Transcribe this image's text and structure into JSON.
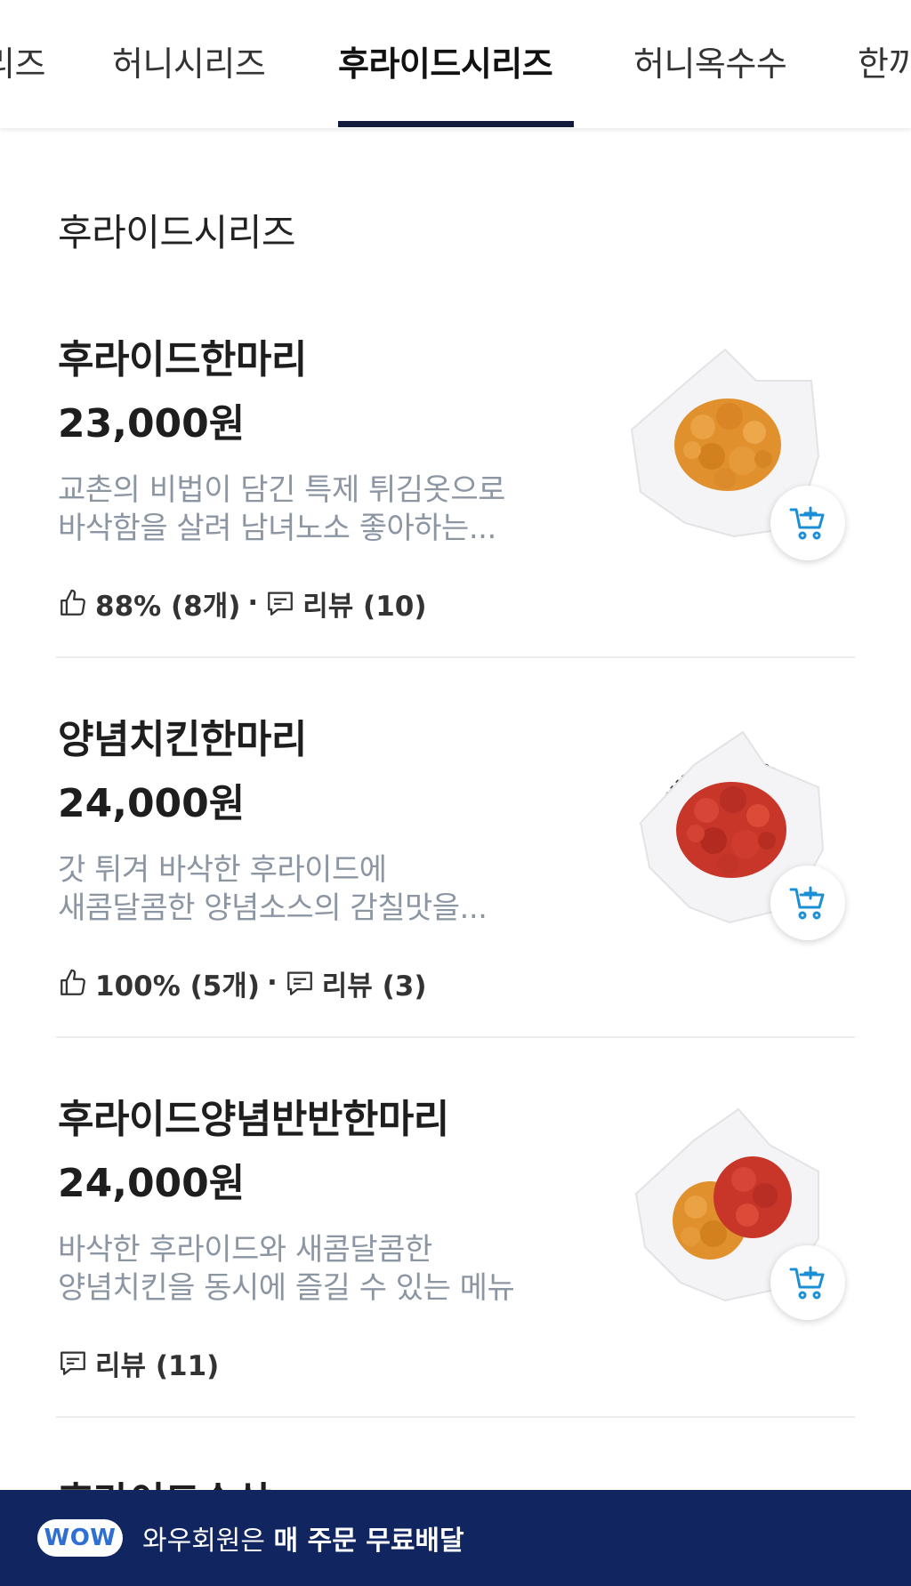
{
  "tabs": [
    {
      "label": "리즈",
      "active": false
    },
    {
      "label": "허니시리즈",
      "active": false
    },
    {
      "label": "후라이드시리즈",
      "active": true
    },
    {
      "label": "허니옥수수",
      "active": false
    },
    {
      "label": "한끼",
      "active": false
    }
  ],
  "section": {
    "title": "후라이드시리즈"
  },
  "items": [
    {
      "name": "후라이드한마리",
      "price": "23,000원",
      "desc_line1": "교촌의 비법이 담긴 특제 튀김옷으로",
      "desc_line2": "바삭함을 살려 남녀노소 좋아하는...",
      "rating": "88% (8개)",
      "review": "리뷰 (10)",
      "image": "fried-chicken-basket"
    },
    {
      "name": "양념치킨한마리",
      "price": "24,000원",
      "desc_line1": "갓 튀겨 바삭한 후라이드에",
      "desc_line2": "새콤달콤한 양념소스의 감칠맛을...",
      "rating": "100% (5개)",
      "review": "리뷰 (3)",
      "image": "seasoned-chicken-basket"
    },
    {
      "name": "후라이드양념반반한마리",
      "price": "24,000원",
      "desc_line1": "바삭한 후라이드와 새콤달콤한",
      "desc_line2": "양념치킨을 동시에 즐길 수 있는 메뉴",
      "rating": "",
      "review": "리뷰 (11)",
      "image": "half-half-chicken-basket"
    }
  ],
  "peek_item": {
    "name": "후라이드순살"
  },
  "banner": {
    "badge": "WOW",
    "text_normal": "와우회원은 ",
    "text_bold": "매 주문 무료배달"
  },
  "colors": {
    "tab_underline": "#151b3d",
    "banner_bg": "#112561",
    "desc_gray": "#8c96a3",
    "cart_icon": "#1b8fd6",
    "fried": "#e0912e",
    "seasoned": "#c8362a"
  }
}
